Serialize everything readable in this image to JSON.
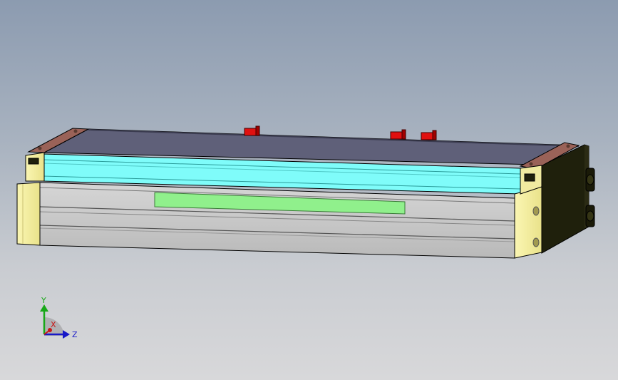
{
  "viewport": {
    "background_top": "#8c9bb0",
    "background_bottom": "#d8d8da"
  },
  "model": {
    "parts": [
      "top-cover-plate",
      "cyan-cover-strip",
      "base-rail-body",
      "green-label-strip",
      "left-end-cap",
      "right-end-cap",
      "red-sensor-clip",
      "brown-end-plate"
    ],
    "colors": {
      "top_plate": "#5f6079",
      "cyan_strip": "#7ffcfa",
      "rail_body": "#c8c8c8",
      "green_strip": "#90f08c",
      "end_cap_yellow": "#f5f0a0",
      "end_cap_dark": "#20200a",
      "sensor_red": "#e01010",
      "end_plate_brown": "#9a6258"
    }
  },
  "triad": {
    "y_label": "Y",
    "z_label": "Z",
    "x_label": "X",
    "colors": {
      "y": "#18a818",
      "z": "#1818c8",
      "x": "#c81818"
    }
  }
}
